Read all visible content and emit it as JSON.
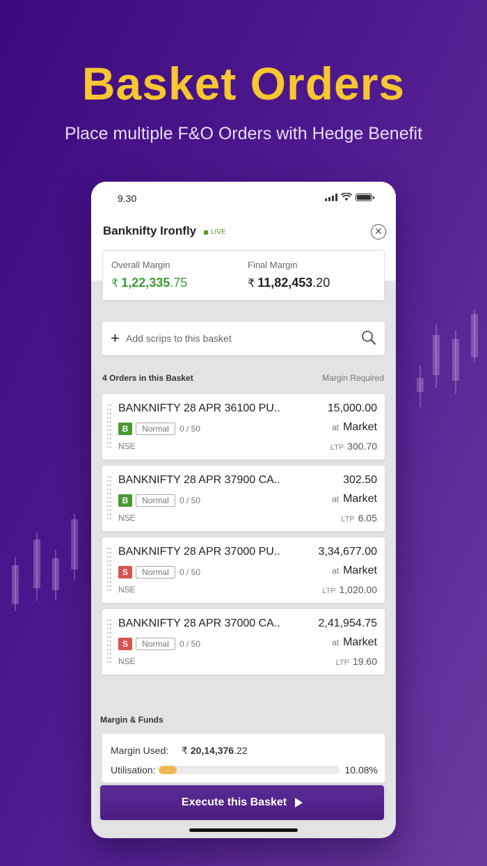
{
  "hero": {
    "title": "Basket Orders",
    "subtitle": "Place multiple F&O Orders with Hedge Benefit"
  },
  "colors": {
    "accent_yellow": "#f7c630",
    "background_purple": "#4f1a8f",
    "buy_green": "#4a9a32",
    "sell_red": "#d9534f",
    "execute_purple": "#5c2b96"
  },
  "status_bar": {
    "time": "9.30",
    "icons": [
      "signal-icon",
      "wifi-icon",
      "battery-icon"
    ]
  },
  "basket": {
    "title": "Banknifty Ironfly",
    "live_label": "LIVE",
    "close_icon": "close-icon"
  },
  "margins": {
    "overall_label": "Overall Margin",
    "overall_symbol": "₹",
    "overall_main": "1,22,335",
    "overall_decimal": ".75",
    "final_label": "Final Margin",
    "final_symbol": "₹",
    "final_main": "11,82,453",
    "final_decimal": ".20"
  },
  "search": {
    "plus": "+",
    "placeholder": "Add scrips to this basket",
    "icon": "search-icon"
  },
  "orders_header": {
    "count_label": "4 Orders in this Basket",
    "right_label": "Margin Required"
  },
  "orders": [
    {
      "name": "BANKNIFTY 28 APR 36100 PU..",
      "amount": "15,000.00",
      "side": "B",
      "type": "Normal",
      "qty": "0 / 50",
      "at": "at",
      "price_type": "Market",
      "exchange": "NSE",
      "ltp_label": "LTP",
      "ltp": "300.70"
    },
    {
      "name": "BANKNIFTY 28 APR 37900 CA..",
      "amount": "302.50",
      "side": "B",
      "type": "Normal",
      "qty": "0 / 50",
      "at": "at",
      "price_type": "Market",
      "exchange": "NSE",
      "ltp_label": "LTP",
      "ltp": "6.05"
    },
    {
      "name": "BANKNIFTY 28 APR 37000 PU..",
      "amount": "3,34,677.00",
      "side": "S",
      "type": "Normal",
      "qty": "0 / 50",
      "at": "at",
      "price_type": "Market",
      "exchange": "NSE",
      "ltp_label": "LTP",
      "ltp": "1,020.00"
    },
    {
      "name": "BANKNIFTY 28 APR 37000 CA..",
      "amount": "2,41,954.75",
      "side": "S",
      "type": "Normal",
      "qty": "0 / 50",
      "at": "at",
      "price_type": "Market",
      "exchange": "NSE",
      "ltp_label": "LTP",
      "ltp": "19.60"
    }
  ],
  "funds": {
    "header": "Margin & Funds",
    "used_label": "Margin Used:",
    "used_symbol": "₹",
    "used_main": "20,14,376",
    "used_decimal": ".22",
    "utilisation_label": "Utilisation:",
    "utilisation_pct": "10.08%",
    "utilisation_value": 10.08
  },
  "execute": {
    "label": "Execute this Basket",
    "icon": "play-icon"
  }
}
